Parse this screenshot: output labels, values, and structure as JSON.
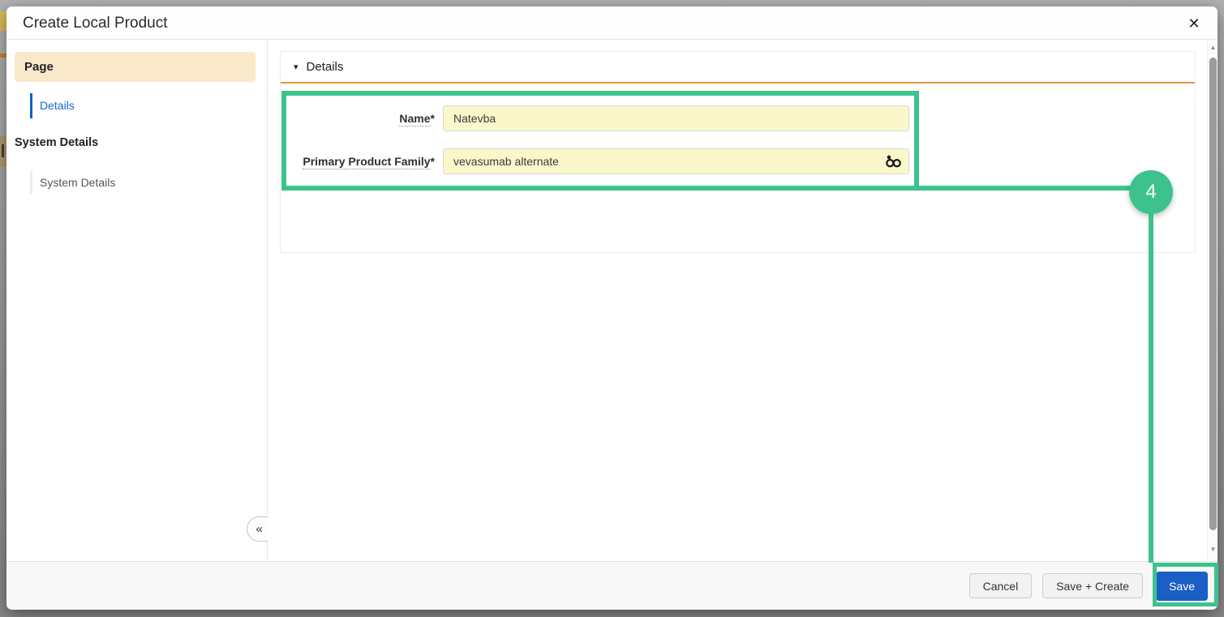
{
  "modal": {
    "title": "Create Local Product"
  },
  "icons": {
    "close": "✕",
    "section_collapse": "▾",
    "sidebar_collapse": "«",
    "scroll_up": "▲",
    "scroll_down": "▼"
  },
  "sidebar": {
    "page_header": "Page",
    "page_items": [
      {
        "label": "Details",
        "active": true
      }
    ],
    "system_header": "System Details",
    "system_items": [
      {
        "label": "System Details"
      }
    ]
  },
  "details_section": {
    "title": "Details",
    "fields": [
      {
        "label": "Name",
        "required_marker": "*",
        "value": "Natevba"
      },
      {
        "label": "Primary Product Family",
        "required_marker": "*",
        "value": "vevasumab alternate",
        "lookup_icon": "binoculars"
      }
    ]
  },
  "footer": {
    "cancel_label": "Cancel",
    "save_create_label": "Save + Create",
    "save_label": "Save"
  },
  "annotation": {
    "step_number": "4"
  },
  "colors": {
    "annotation_green": "#3dc28e",
    "save_button_blue": "#1b5ec6",
    "active_section_peach": "#fae8cb",
    "section_underline_orange": "#e09a3e",
    "required_field_yellow": "#faf7cb",
    "active_link_blue": "#1767c9"
  }
}
